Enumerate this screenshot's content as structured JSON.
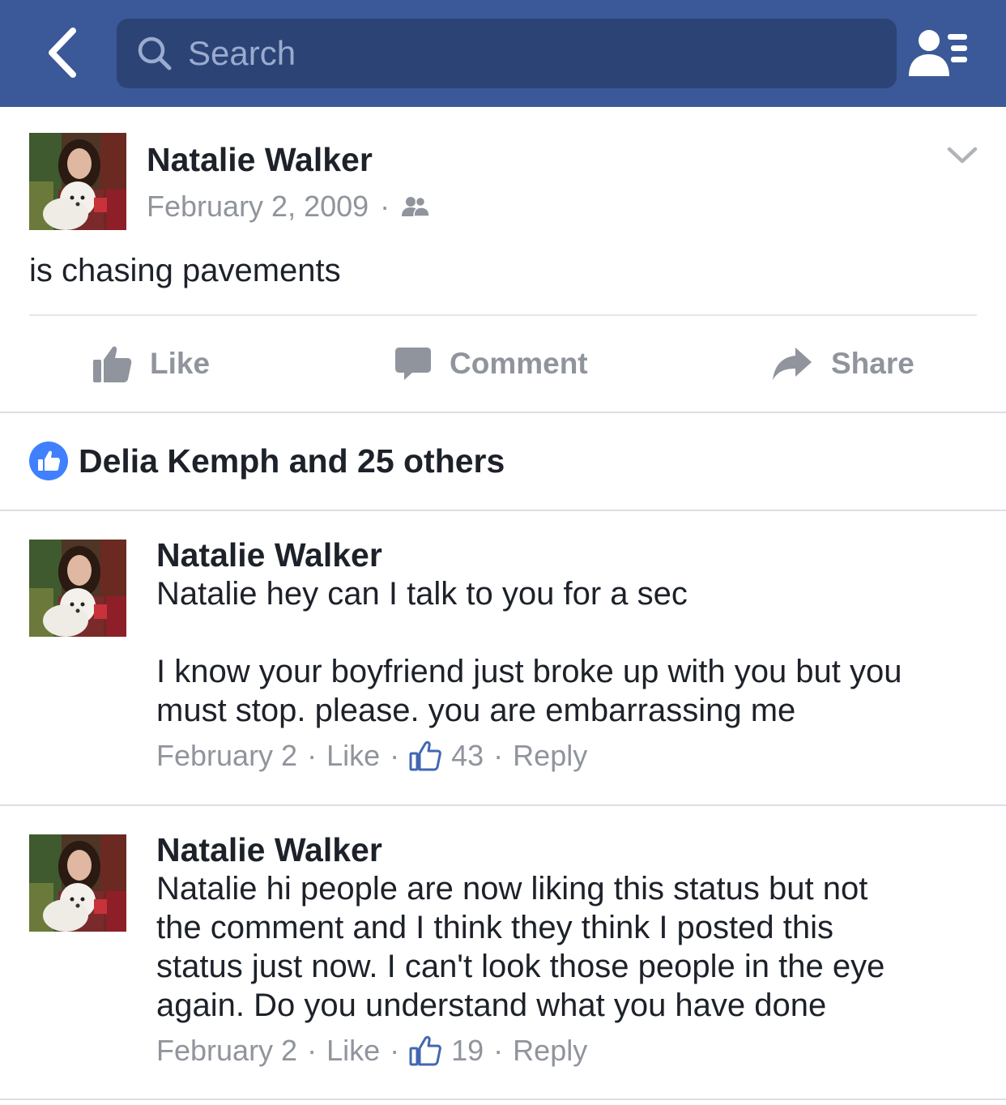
{
  "nav": {
    "back_icon": "chevron-left-icon",
    "search_placeholder": "Search",
    "search_icon": "search-icon",
    "friends_icon": "friend-requests-icon",
    "bar_color": "#3b5998",
    "search_bg": "#2c4375"
  },
  "post": {
    "author": "Natalie Walker",
    "date": "February 2, 2009",
    "separator": "·",
    "audience_icon": "friends-audience-icon",
    "menu_icon": "chevron-down-icon",
    "text": "is chasing pavements"
  },
  "actions": {
    "like": "Like",
    "comment": "Comment",
    "share": "Share"
  },
  "likes": {
    "summary": "Delia Kemph and 25 others",
    "badge_color": "#4080ff"
  },
  "comments": [
    {
      "author": "Natalie Walker",
      "lines": [
        "Natalie hey can I talk to you for a sec",
        "",
        "I know your boyfriend just broke up with you but you",
        "must stop. please. you are embarrassing me"
      ],
      "date": "February 2",
      "like_label": "Like",
      "like_count": "43",
      "reply_label": "Reply"
    },
    {
      "author": "Natalie Walker",
      "lines": [
        "Natalie hi people are now liking this status but not",
        "the comment and I think they think I posted this",
        "status just now. I can't look those people in the eye",
        "again. Do you understand what you have done"
      ],
      "date": "February 2",
      "like_label": "Like",
      "like_count": "19",
      "reply_label": "Reply"
    }
  ]
}
